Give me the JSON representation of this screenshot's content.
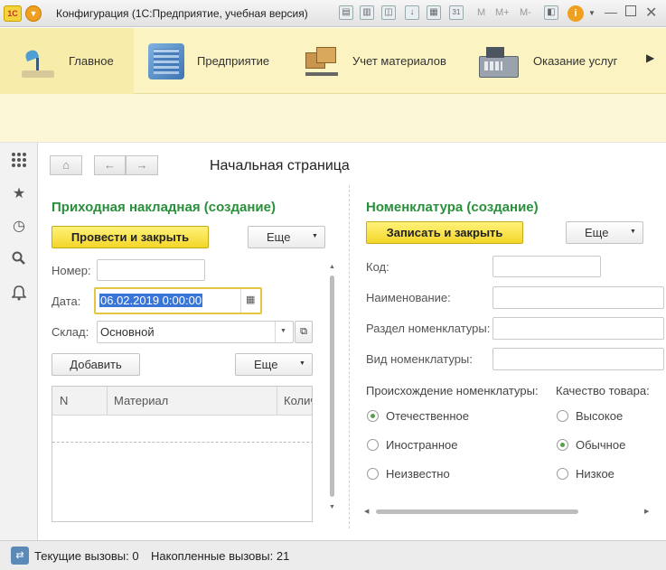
{
  "window": {
    "title": "Конфигурация (1С:Предприятие, учебная версия)",
    "logo_text": "1С",
    "toolbar_text": [
      "M",
      "M+",
      "M-"
    ],
    "calendar_day": "31"
  },
  "sections": [
    {
      "label": "Главное",
      "icon": "desk-lamp-icon",
      "active": true
    },
    {
      "label": "Предприятие",
      "icon": "building-icon",
      "active": false
    },
    {
      "label": "Учет материалов",
      "icon": "boxes-cart-icon",
      "active": false
    },
    {
      "label": "Оказание услуг",
      "icon": "cash-register-icon",
      "active": false
    }
  ],
  "sidebar": [
    "apps-grid-icon",
    "star-icon",
    "history-icon",
    "search-icon",
    "bell-icon"
  ],
  "page": {
    "title": "Начальная страница"
  },
  "receipt_form": {
    "title": "Приходная накладная (создание)",
    "post_close_label": "Провести и закрыть",
    "more_label": "Еще",
    "number_label": "Номер:",
    "number_value": "",
    "date_label": "Дата:",
    "date_value": "06.02.2019  0:00:00",
    "warehouse_label": "Склад:",
    "warehouse_value": "Основной",
    "add_label": "Добавить",
    "table_more_label": "Еще",
    "columns": [
      "N",
      "Материал",
      "Колич"
    ]
  },
  "nomenclature_form": {
    "title": "Номенклатура (создание)",
    "save_close_label": "Записать и закрыть",
    "more_label": "Еще",
    "fields": {
      "code": "Код:",
      "name": "Наименование:",
      "section": "Раздел номенклатуры:",
      "kind": "Вид номенклатуры:"
    },
    "origin_title": "Происхождение номенклатуры:",
    "origin_options": [
      {
        "label": "Отечественное",
        "selected": true
      },
      {
        "label": "Иностранное",
        "selected": false
      },
      {
        "label": "Неизвестно",
        "selected": false
      }
    ],
    "quality_title": "Качество товара:",
    "quality_options": [
      {
        "label": "Высокое",
        "selected": false
      },
      {
        "label": "Обычное",
        "selected": true
      },
      {
        "label": "Низкое",
        "selected": false
      }
    ]
  },
  "status": {
    "current_calls": "Текущие вызовы: 0",
    "accumulated_calls": "Накопленные вызовы: 21"
  },
  "colors": {
    "accent_green": "#2a8f3b",
    "section_bar": "#fbf4c2",
    "primary_button": "#f3d629"
  }
}
